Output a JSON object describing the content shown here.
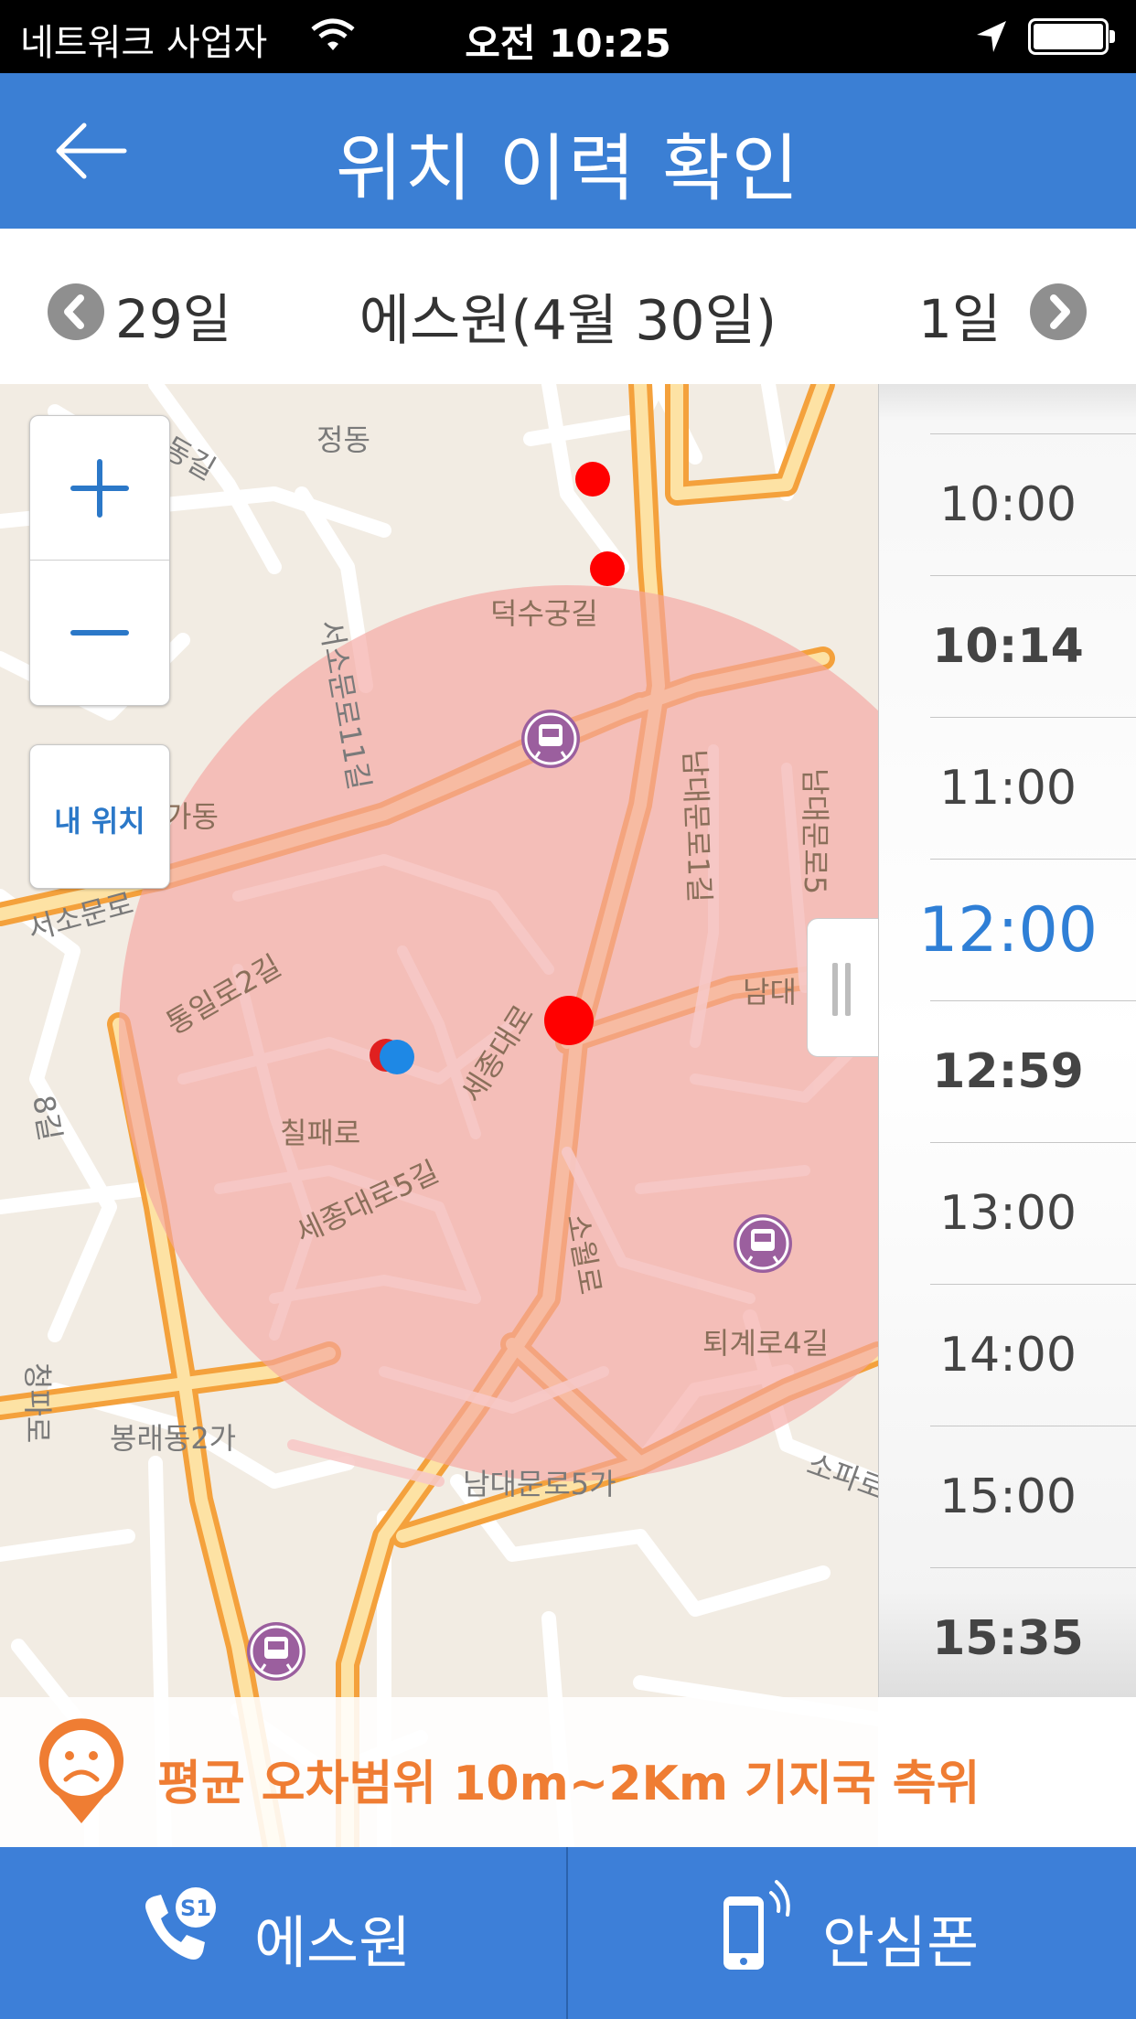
{
  "status_bar": {
    "carrier": "네트워크 사업자",
    "time": "오전 10:25",
    "icons": [
      "wifi-icon",
      "location-arrow-icon",
      "battery-icon"
    ]
  },
  "header": {
    "back_icon": "back-arrow-icon",
    "title": "위치 이력 확인"
  },
  "date_nav": {
    "prev_label": "29일",
    "current_label": "에스원(4월 30일)",
    "next_label": "1일"
  },
  "map": {
    "zoom_in_icon": "plus-icon",
    "zoom_out_icon": "minus-icon",
    "my_location_label": "내 위치",
    "place_labels": [
      "정동",
      "덕수궁길",
      "서소문로11길",
      "남대문로1길",
      "남대문로5",
      "서소문로",
      "통일로2길",
      "세종대로",
      "세종대로5길",
      "칠패로",
      "소월로",
      "퇴계로4길",
      "봉래동2가",
      "남대문로5가",
      "소파로",
      "청파로",
      "남대",
      "동길",
      "8길",
      "가동"
    ],
    "accuracy_circle_color": "#f4a6a2",
    "history_point_color": "#ff0000",
    "current_point_color": "#1e88e5"
  },
  "time_list": {
    "items": [
      {
        "label": "10:00",
        "bold": false,
        "active": false
      },
      {
        "label": "10:14",
        "bold": true,
        "active": false
      },
      {
        "label": "11:00",
        "bold": false,
        "active": false
      },
      {
        "label": "12:00",
        "bold": false,
        "active": true
      },
      {
        "label": "12:59",
        "bold": true,
        "active": false
      },
      {
        "label": "13:00",
        "bold": false,
        "active": false
      },
      {
        "label": "14:00",
        "bold": false,
        "active": false
      },
      {
        "label": "15:00",
        "bold": false,
        "active": false
      },
      {
        "label": "15:35",
        "bold": true,
        "active": false
      }
    ]
  },
  "banner": {
    "icon": "sad-face-pin-icon",
    "text": "평균 오차범위 10m~2Km 기지국 측위",
    "color": "#ef7d33"
  },
  "tabs": [
    {
      "label": "에스원",
      "icon": "phone-s1-icon"
    },
    {
      "label": "안심폰",
      "icon": "mobile-phone-icon"
    }
  ],
  "colors": {
    "header_bg": "#3b7fd4",
    "tab_bg": "#3d7fd8",
    "active_time": "#2f7fd6"
  }
}
